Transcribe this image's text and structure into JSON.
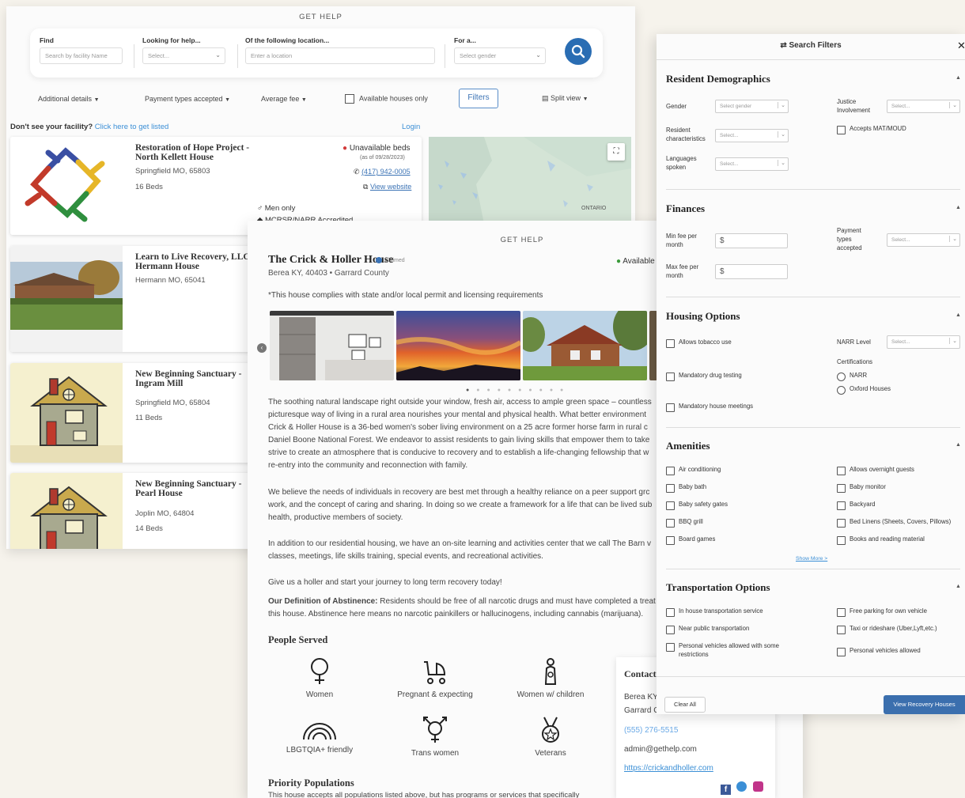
{
  "results": {
    "header": "GET HELP",
    "search": {
      "find_label": "Find",
      "find_placeholder": "Search by facility Name",
      "help_label": "Looking for help...",
      "help_select": "Select...",
      "location_label": "Of the following location...",
      "location_placeholder": "Enter a location",
      "for_label": "For a...",
      "for_select": "Select gender"
    },
    "filters": {
      "additional": "Additional details",
      "payment": "Payment types accepted",
      "fee": "Average fee",
      "available": "Available houses only",
      "filters_btn": "Filters",
      "split": "Split view"
    },
    "not_listed_q": "Don't see your facility?",
    "not_listed_link": "Click here to get listed",
    "login": "Login",
    "cards": [
      {
        "title": "Restoration of Hope Project - North Kellett House",
        "location": "Springfield MO, 65803",
        "beds": "16 Beds",
        "status": "Unavailable beds",
        "status_date": "(as of 09/28/2023)",
        "phone": "(417) 942-0005",
        "website": "View website",
        "gender": "Men only",
        "accredited": "MCRSR/NARR Accredited"
      },
      {
        "title": "Learn to Live Recovery, LLC - Hermann House",
        "location": "Hermann MO, 65041"
      },
      {
        "title": "New Beginning Sanctuary - Ingram Mill",
        "location": "Springfield MO, 65804",
        "beds": "11 Beds"
      },
      {
        "title": "New Beginning Sanctuary - Pearl House",
        "location": "Joplin MO, 64804",
        "beds": "14 Beds"
      }
    ],
    "map_label": "ONTARIO"
  },
  "detail": {
    "header": "GET HELP",
    "title": "The Crick & Holler House",
    "claimed": "Claimed",
    "available": "Available",
    "location": "Berea KY, 40403 • Garrard County",
    "compliance": "*This house complies with state and/or local permit and licensing requirements",
    "paragraphs": [
      [
        "The soothing natural landscape right outside your window, fresh air, access to ample green space – countless",
        "picturesque way of living in a rural area nourishes your mental and physical health. What better environment",
        "Crick & Holler House is a 36-bed women's sober living environment on a 25 acre former horse farm in rural c",
        "Daniel Boone National Forest. We endeavor to assist residents to gain living skills that empower them to take",
        "strive to create an atmosphere that is conducive to recovery and to establish a life-changing fellowship that w",
        "re-entry into the community and reconnection with family."
      ],
      [
        "We believe the needs of individuals in recovery are best met through a healthy reliance on a peer support grc",
        "work, and the concept of caring and sharing. In doing so we create a framework for a life that can be lived sub",
        "health, productive members of society."
      ],
      [
        "In addition to our residential housing, we have an on-site learning and activities center that we call The Barn v",
        "classes, meetings, life skills training, special events, and recreational activities."
      ],
      [
        "Give us a holler and start your journey to long term recovery today!"
      ]
    ],
    "abstinence_label": "Our Definition of Abstinence:",
    "abstinence_text": " Residents should be free of all narcotic drugs and must have completed a treat",
    "abstinence_text2": "this house. Abstinence here means no narcotic painkillers or hallucinogens, including cannabis (marijuana).",
    "people_served_title": "People Served",
    "people_served": [
      "Women",
      "Pregnant & expecting",
      "Women w/ children",
      "LBGTQIA+ friendly",
      "Trans women",
      "Veterans"
    ],
    "priority_title": "Priority Populations",
    "priority_text": "This house accepts all populations listed above, but has programs or services that specifically",
    "contact": {
      "title": "Contact",
      "city": "Berea KY",
      "county": "Garrard C...",
      "phone": "(555) 276-5515",
      "email": "admin@gethelp.com",
      "url": "https://crickandholler.com"
    }
  },
  "filters_panel": {
    "title": "Search Filters",
    "demographics": {
      "title": "Resident Demographics",
      "gender": "Gender",
      "gender_select": "Select gender",
      "justice": "Justice Involvement",
      "justice_select": "Select...",
      "characteristics": "Resident characteristics",
      "characteristics_select": "Select...",
      "mat": "Accepts MAT/MOUD",
      "languages": "Languages spoken",
      "languages_select": "Select..."
    },
    "finances": {
      "title": "Finances",
      "min_fee": "Min fee per month",
      "max_fee": "Max fee per month",
      "currency": "$",
      "payment": "Payment types accepted",
      "payment_select": "Select..."
    },
    "housing": {
      "title": "Housing Options",
      "tobacco": "Allows tobacco use",
      "drug_testing": "Mandatory drug testing",
      "meetings": "Mandatory house meetings",
      "narr_level": "NARR Level",
      "narr_select": "Select...",
      "certifications": "Certifications",
      "cert_narr": "NARR",
      "cert_oxford": "Oxford Houses"
    },
    "amenities": {
      "title": "Amenities",
      "left": [
        "Air conditioning",
        "Baby bath",
        "Baby safety gates",
        "BBQ grill",
        "Board games"
      ],
      "right": [
        "Allows overnight guests",
        "Baby monitor",
        "Backyard",
        "Bed Linens (Sheets, Covers, Pillows)",
        "Books and reading material"
      ],
      "show_more": "Show More >"
    },
    "transport": {
      "title": "Transportation Options",
      "in_house": "In house transportation service",
      "public": "Near public transportation",
      "personal_some": "Personal vehicles allowed with some restrictions",
      "free_parking": "Free parking for own vehicle",
      "taxi": "Taxi or rideshare (Uber,Lyft,etc.)",
      "personal": "Personal vehicles allowed"
    },
    "clear_all": "Clear All",
    "view_btn": "View Recovery Houses"
  }
}
